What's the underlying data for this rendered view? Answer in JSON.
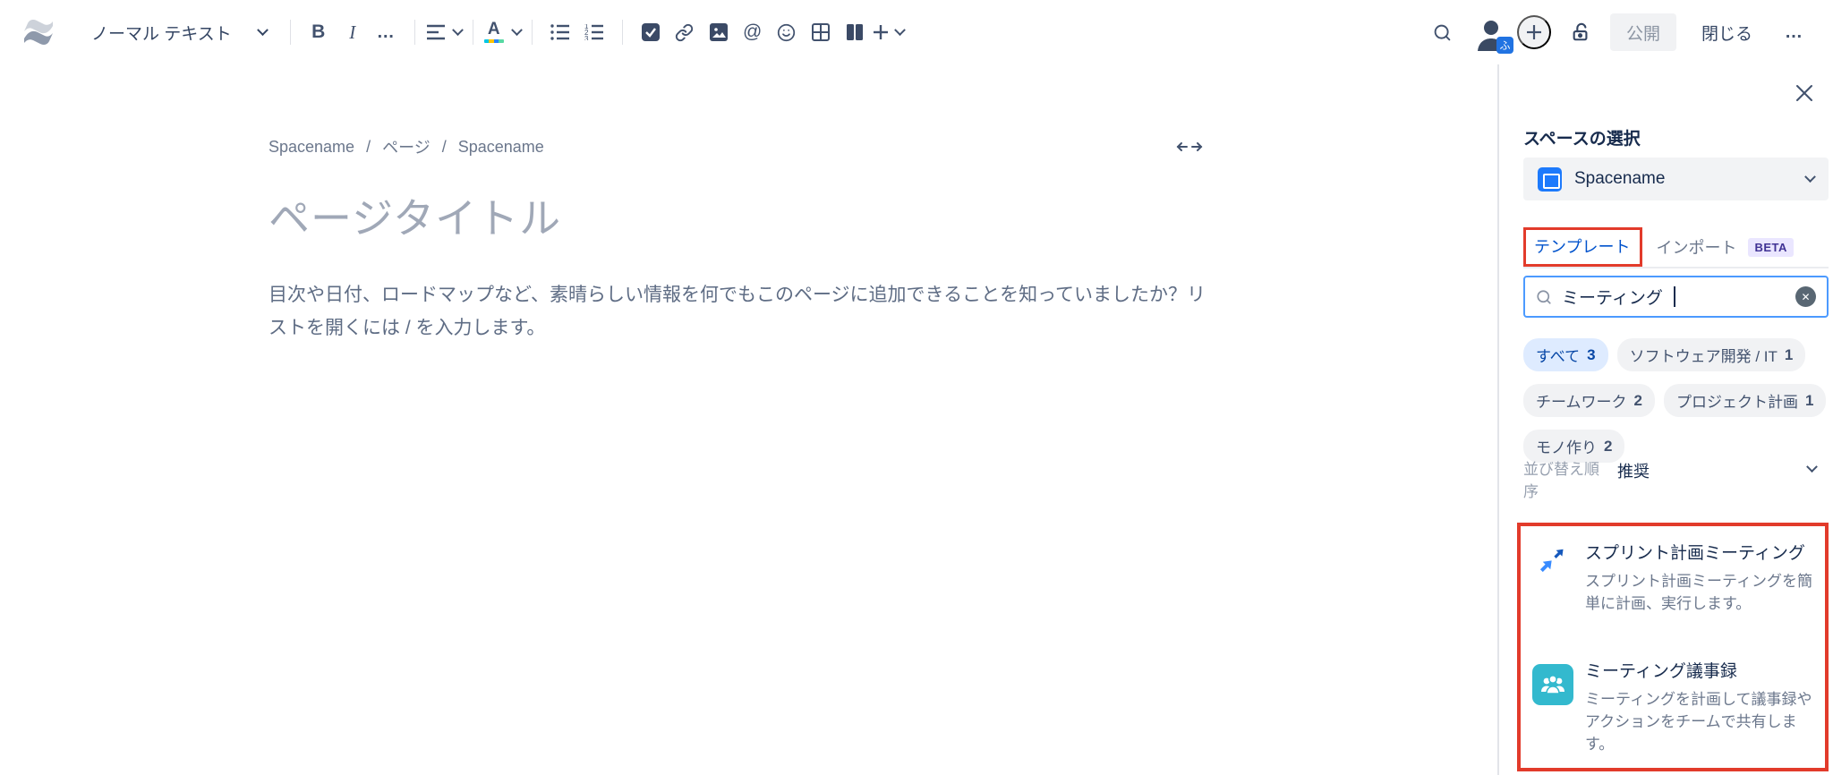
{
  "topbar": {
    "text_style_label": "ノーマル テキスト",
    "bold_label": "B",
    "italic_label": "I",
    "more_label": "…",
    "mention_label": "@",
    "publish_label": "公開",
    "close_label": "閉じる",
    "more_right_label": "…",
    "avatar_badge": "ふ"
  },
  "editor": {
    "breadcrumb": {
      "space": "Spacename",
      "middle": "ページ",
      "page": "Spacename",
      "separator": "/"
    },
    "title_placeholder": "ページタイトル",
    "body_text": "目次や日付、ロードマップなど、素晴らしい情報を何でもこのページに追加できることを知っていましたか？リストを開くには / を入力します。"
  },
  "sidebar": {
    "space_select_label": "スペースの選択",
    "space_name": "Spacename",
    "tab_templates": "テンプレート",
    "tab_import": "インポート",
    "beta_badge": "BETA",
    "search_value": "ミーティング",
    "clear_glyph": "✕",
    "filters": [
      {
        "label": "すべて",
        "count": "3",
        "selected": true
      },
      {
        "label": "ソフトウェア開発 / IT",
        "count": "1",
        "selected": false
      },
      {
        "label": "チームワーク",
        "count": "2",
        "selected": false
      },
      {
        "label": "プロジェクト計画",
        "count": "1",
        "selected": false
      },
      {
        "label": "モノ作り",
        "count": "2",
        "selected": false
      }
    ],
    "sort_label": "並び替え順序",
    "sort_value": "推奨",
    "templates": [
      {
        "icon": "jira-icon",
        "title": "スプリント計画ミーティング",
        "description": "スプリント計画ミーティングを簡単に計画、実行します。"
      },
      {
        "icon": "meeting-people-icon",
        "title": "ミーティング議事録",
        "description": "ミーティングを計画して議事録やアクションをチームで共有します。"
      }
    ]
  },
  "colors": {
    "accent_blue": "#0052CC",
    "annotation_red": "#E23B2B",
    "search_border": "#4C9AFF",
    "beta_badge_bg": "#EAE6FF",
    "beta_badge_text": "#403294",
    "selected_chip_bg": "#DEEBFF",
    "selected_chip_text": "#0747A6",
    "space_icon_blue": "#1D7AFC",
    "jira_blue": "#2684FF",
    "meeting_icon_teal": "#33B9CE",
    "avatar_orange": "#EFA03C",
    "toolbar_icon": "#42526E"
  }
}
